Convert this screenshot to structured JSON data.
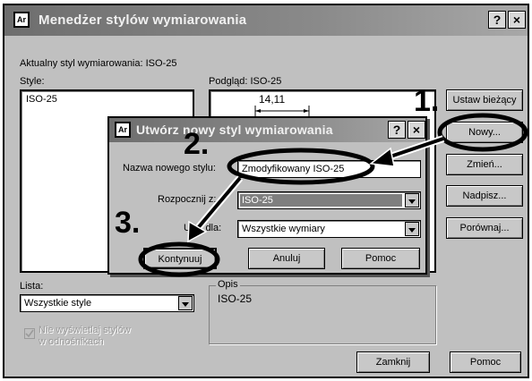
{
  "main_window": {
    "title": "Menedżer stylów wymiarowania",
    "icon_text": "Ar",
    "help_btn": "?",
    "close_btn": "×",
    "current_style_label": "Aktualny styl wymiarowania: ISO-25",
    "styles_label": "Style:",
    "styles_list": [
      "ISO-25"
    ],
    "preview_label": "Podgląd: ISO-25",
    "preview_dimension": "14,11",
    "buttons": {
      "set_current": "Ustaw bieżący",
      "new": "Nowy...",
      "modify": "Zmień...",
      "override": "Nadpisz...",
      "compare": "Porównaj..."
    },
    "list_label": "Lista:",
    "list_value": "Wszystkie style",
    "dont_list_checkbox_line1": "Nie wyświetlaj stylów",
    "dont_list_checkbox_line2": "w odnośnikach",
    "description_group": "Opis",
    "description_text": "ISO-25",
    "close_button": "Zamknij",
    "help_button": "Pomoc"
  },
  "new_style_dialog": {
    "title": "Utwórz nowy styl wymiarowania",
    "icon_text": "Ar",
    "help_btn": "?",
    "close_btn": "×",
    "name_label": "Nazwa nowego stylu:",
    "name_value": "Zmodyfikowany ISO-25",
    "start_with_label": "Rozpocznij z:",
    "start_with_value": "ISO-25",
    "use_for_label": "Użyj dla:",
    "use_for_value": "Wszystkie wymiary",
    "continue_button": "Kontynuuj",
    "cancel_button": "Anuluj",
    "help_button": "Pomoc"
  },
  "annotations": {
    "step1": "1.",
    "step2": "2.",
    "step3": "3."
  },
  "colors": {
    "window_bg": "#c0c0c0",
    "titlebar": "#7a7a7a",
    "selection": "#7f7f7f"
  }
}
